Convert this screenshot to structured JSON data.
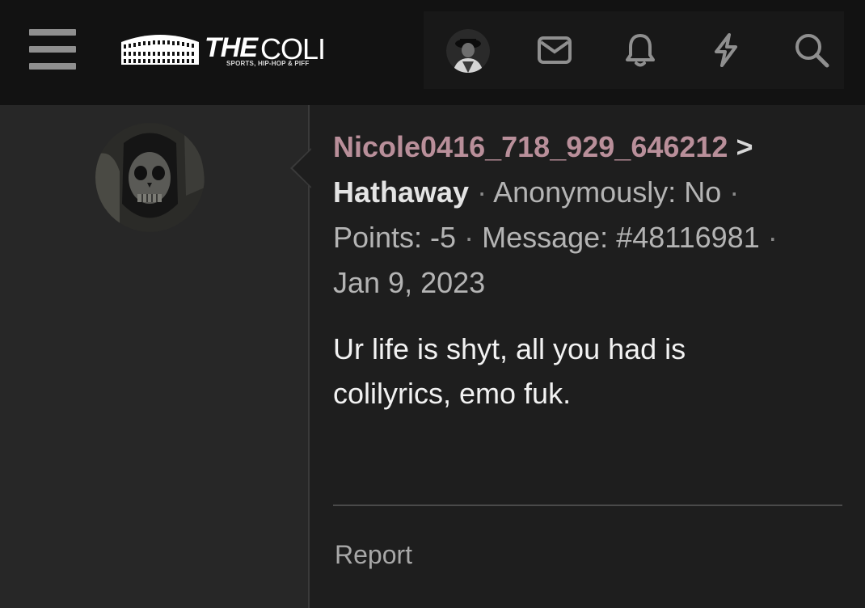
{
  "header": {
    "logo_the": "THE",
    "logo_coli": "COLI",
    "logo_tagline": "SPORTS, HIP-HOP & PIFF"
  },
  "icons": {
    "menu": "hamburger-menu-icon",
    "inbox": "envelope-icon",
    "alerts": "bell-icon",
    "whats_new": "lightning-bolt-icon",
    "search": "search-icon"
  },
  "post": {
    "author": "Nicole0416_718_929_646212",
    "separator": ">",
    "recipient": "Hathaway",
    "anonymous_label": "Anonymously: No",
    "points_label": "Points: -5",
    "message_label": "Message: #48116981",
    "date": "Jan 9, 2023",
    "body_line1": "Ur life is shyt, all you had is",
    "body_line2": "colilyrics, emo fuk.",
    "report_label": "Report"
  },
  "colors": {
    "author": "#b98f9a",
    "background": "#1e1e1e",
    "header": "#121212",
    "sidebar": "#272727"
  }
}
